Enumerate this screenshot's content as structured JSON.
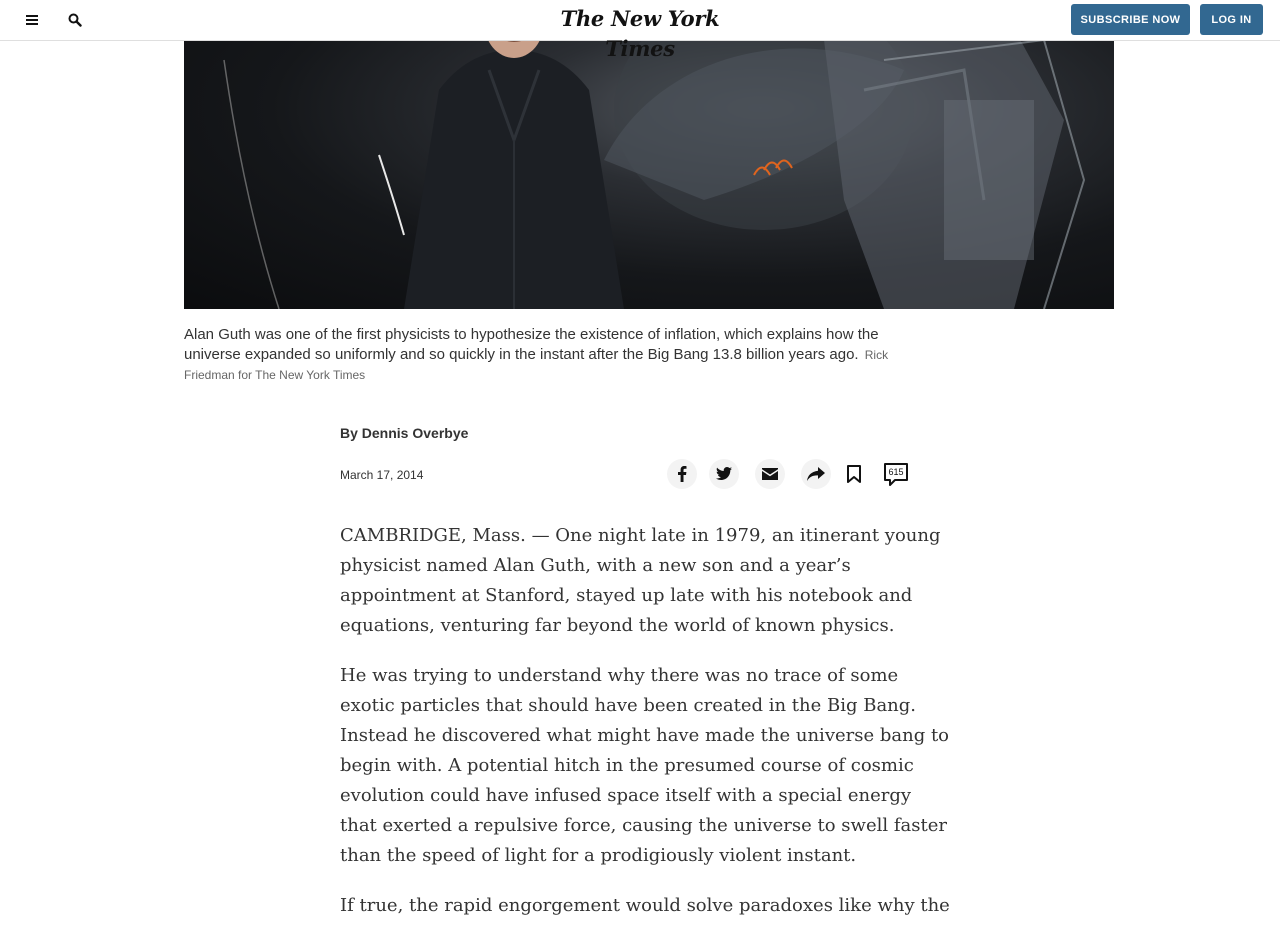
{
  "header": {
    "logo": "The New York Times",
    "subscribe_label": "SUBSCRIBE NOW",
    "login_label": "LOG IN",
    "menu_icon": "hamburger-menu-icon",
    "search_icon": "search-icon",
    "accent_color": "#326891"
  },
  "photo": {
    "caption": "Alan Guth was one of the first physicists to hypothesize the existence of inflation, which explains how the universe expanded so uniformly and so quickly in the instant after the Big Bang 13.8 billion years ago.",
    "credit": "Rick Friedman for The New York Times"
  },
  "article": {
    "byline": "By Dennis Overbye",
    "date": "March 17, 2014",
    "paragraphs": [
      "CAMBRIDGE, Mass. — One night late in 1979, an itinerant young physicist named Alan Guth, with a new son and a year’s appointment at Stanford, stayed up late with his notebook and equations, venturing far beyond the world of known physics.",
      "He was trying to understand why there was no trace of some exotic particles that should have been created in the Big Bang. Instead he discovered what might have made the universe bang to begin with. A potential hitch in the presumed course of cosmic evolution could have infused space itself with a special energy that exerted a repulsive force, causing the universe to swell faster than the speed of light for a prodigiously violent instant.",
      "If true, the rapid engorgement would solve paradoxes like why the"
    ]
  },
  "share_tools": {
    "icons": [
      "facebook-icon",
      "twitter-icon",
      "email-icon",
      "share-icon",
      "bookmark-icon",
      "comments-icon"
    ],
    "comments_count": "615"
  }
}
